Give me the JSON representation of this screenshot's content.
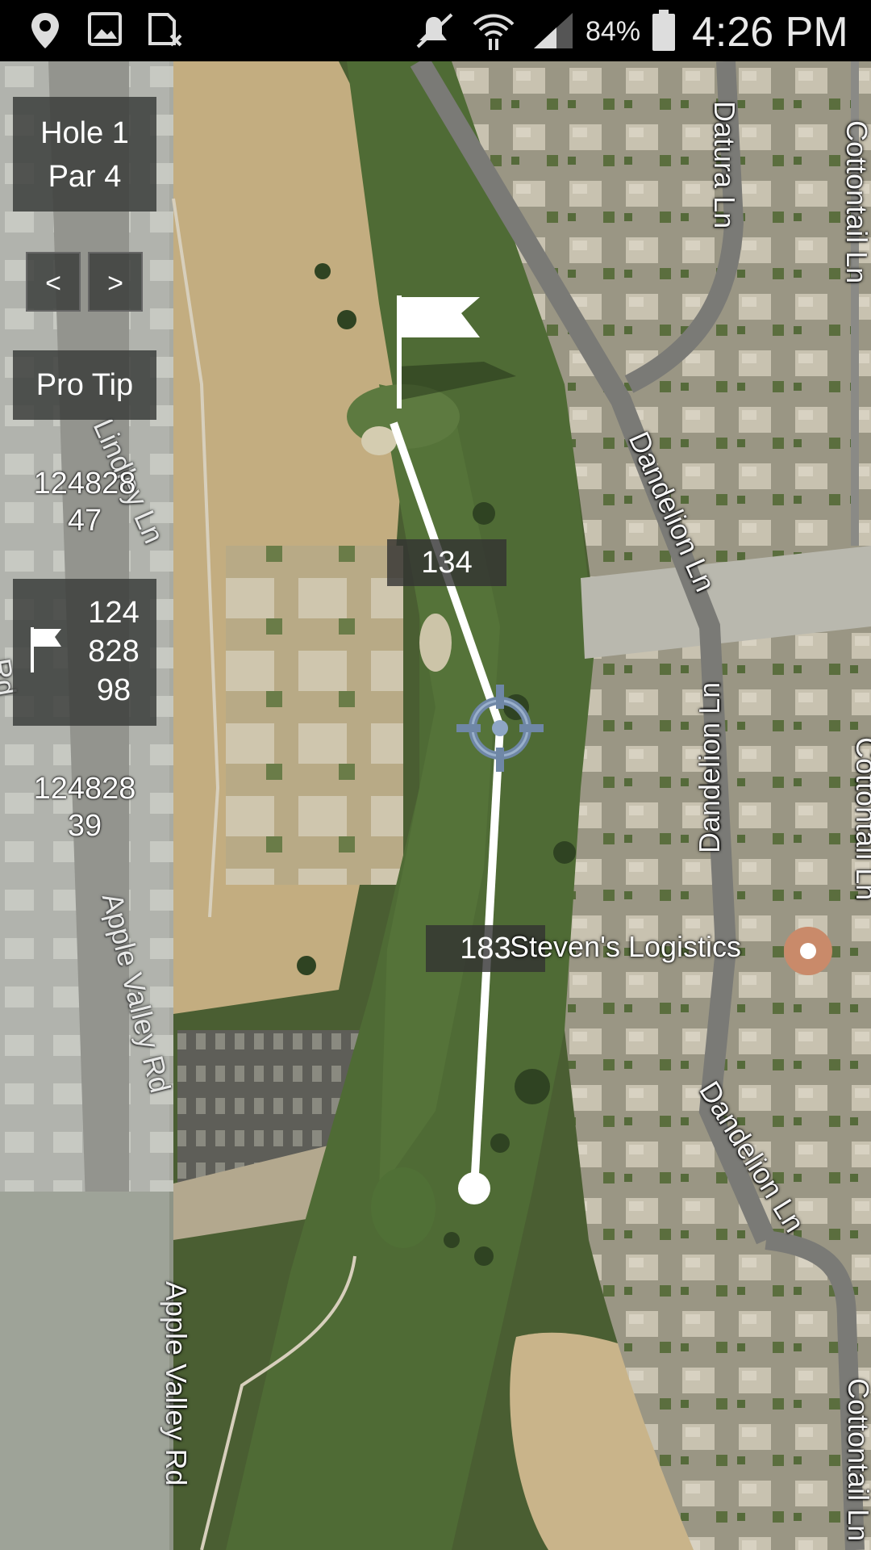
{
  "status_bar": {
    "icons": [
      "location-icon",
      "image-icon",
      "sim-icon",
      "mute-icon",
      "wifi-icon",
      "signal-icon",
      "battery-icon"
    ],
    "battery": "84%",
    "time": "4:26 PM"
  },
  "sidebar": {
    "hole": "Hole 1",
    "par": "Par 4",
    "prev_label": "<",
    "next_label": ">",
    "pro_tip_label": "Pro Tip",
    "top_distance": [
      "124828",
      "47"
    ],
    "flag_distance": [
      "124",
      "828",
      "98"
    ],
    "bottom_distance": [
      "124828",
      "39"
    ]
  },
  "map": {
    "shot_distances": {
      "upper": "134",
      "lower": "183"
    },
    "poi": "Steven's Logistics",
    "streets": {
      "datura": "Datura Ln",
      "dandelion_1": "Dandelion Ln",
      "dandelion_2": "Dandelion Ln",
      "dandelion_3": "Dandelion Ln",
      "lindley": "Lindley Ln",
      "apple_valley_1": "Apple Valley Rd",
      "apple_valley_2": "Apple Valley Rd",
      "cottontail_1": "Cottontail Ln",
      "cottontail_2": "Cottontail Ln",
      "cottontail_3": "Cottontail Ln",
      "left_rd": "Rd"
    }
  },
  "colors": {
    "fairway": "#4f6b35",
    "rough": "#3f5a2a",
    "sand": "#c9b48a",
    "road": "#8a8a8a",
    "panel": "#3c3e3c"
  }
}
